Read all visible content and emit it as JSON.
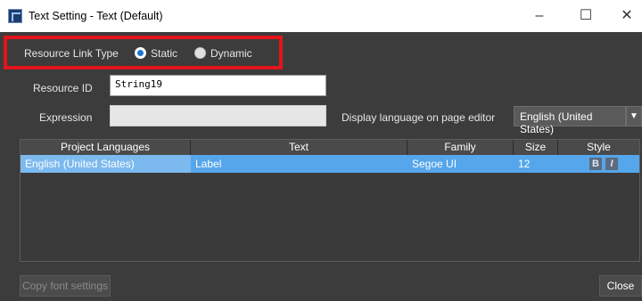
{
  "window": {
    "title": "Text Setting - Text (Default)",
    "minimize": "–",
    "maximize": "☐",
    "close": "✕"
  },
  "resource_link": {
    "label": "Resource Link Type",
    "options": [
      "Static",
      "Dynamic"
    ],
    "selected": "Static"
  },
  "resource_id": {
    "label": "Resource ID",
    "value": "String19"
  },
  "expression": {
    "label": "Expression",
    "value": ""
  },
  "display_language": {
    "label": "Display language on page editor",
    "value": "English (United States)",
    "arrow": "▼"
  },
  "table": {
    "headers": [
      "Project Languages",
      "Text",
      "Family",
      "Size",
      "Style"
    ],
    "rows": [
      {
        "language": "English (United States)",
        "text": "Label",
        "family": "Segoe UI",
        "size": "12",
        "style_bold": "B",
        "style_italic": "I"
      }
    ]
  },
  "buttons": {
    "copy_font": "Copy font settings",
    "close": "Close"
  },
  "colors": {
    "dialog_bg": "#3c3c3c",
    "row_selected": "#55a6ea",
    "highlight_border": "#e3141b",
    "radio_accent": "#1a76d2"
  }
}
